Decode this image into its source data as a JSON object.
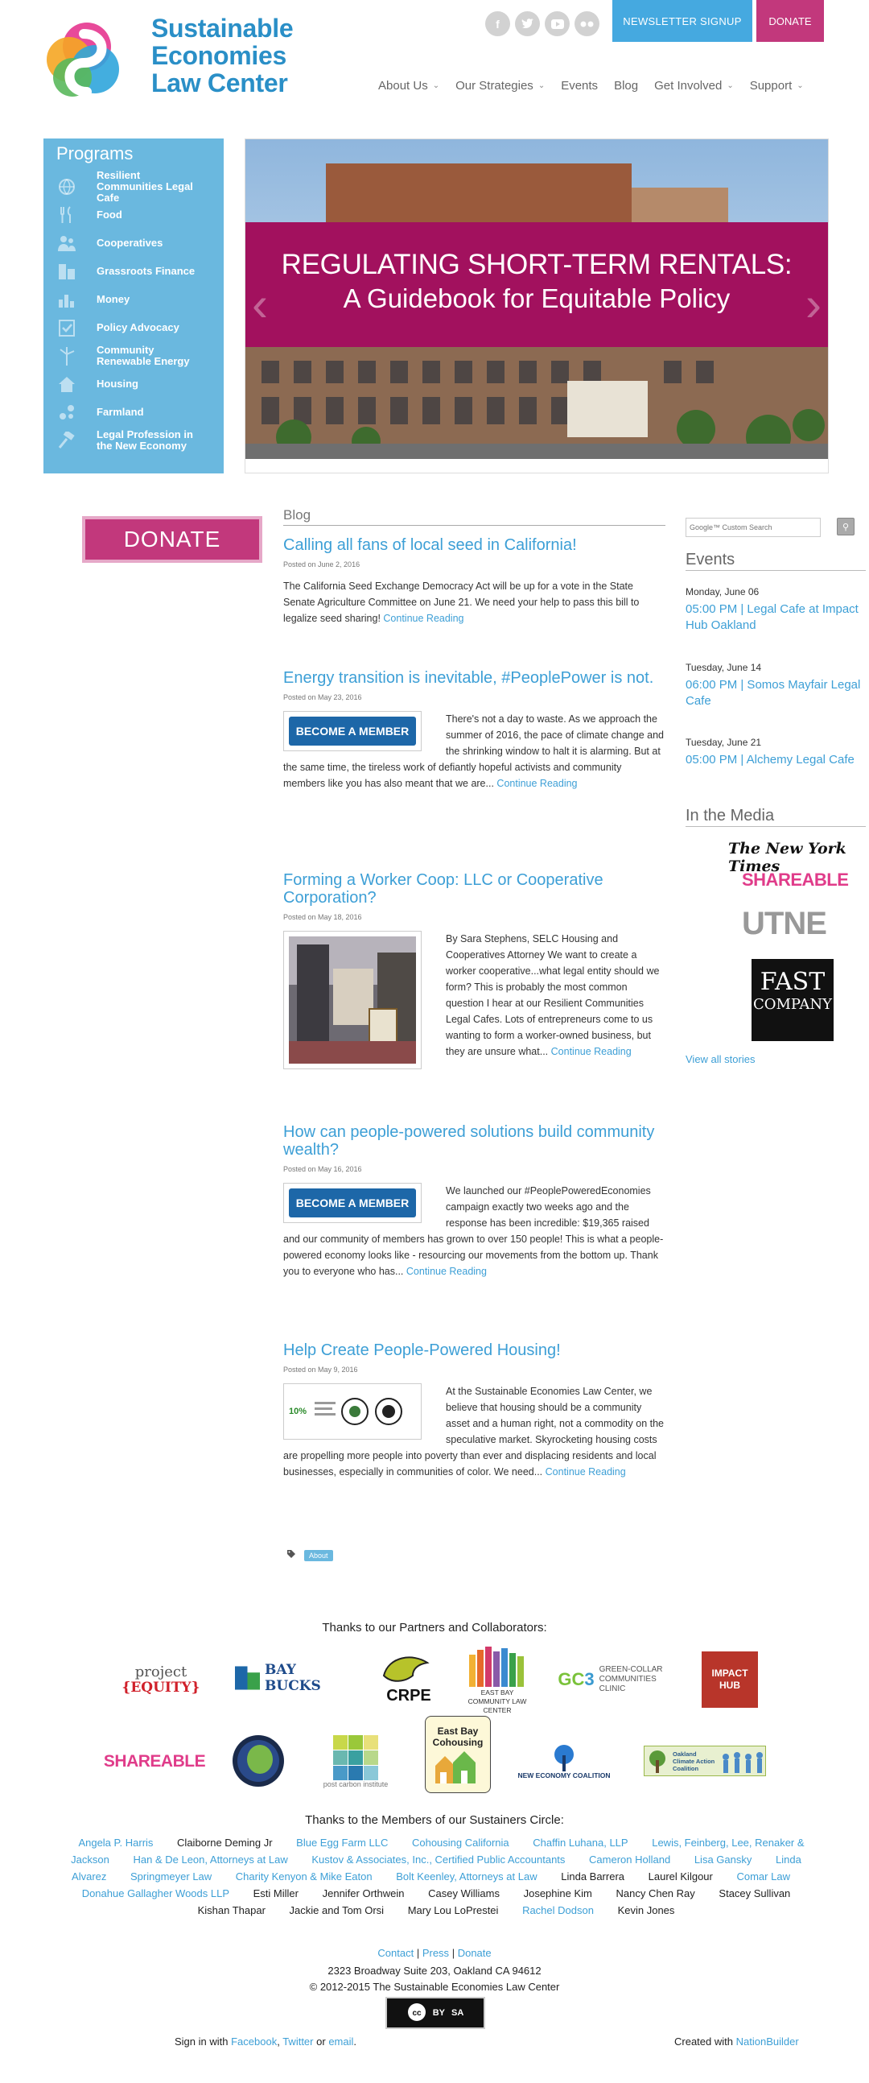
{
  "header": {
    "logo_lines": [
      "Sustainable",
      "Economies",
      "Law Center"
    ],
    "social_icons": [
      "facebook-icon",
      "twitter-icon",
      "youtube-icon",
      "flickr-icon"
    ],
    "newsletter_label": "NEWSLETTER SIGNUP",
    "donate_label": "DONATE",
    "nav": [
      "About Us",
      "Our Strategies",
      "Events",
      "Blog",
      "Get Involved",
      "Support"
    ]
  },
  "programs": {
    "title": "Programs",
    "items": [
      {
        "label": "Resilient Communities Legal Cafe",
        "icon": "globe-icon"
      },
      {
        "label": "Food",
        "icon": "fork-knife-icon"
      },
      {
        "label": "Cooperatives",
        "icon": "people-icon"
      },
      {
        "label": "Grassroots Finance",
        "icon": "buildings-icon"
      },
      {
        "label": "Money",
        "icon": "bar-chart-icon"
      },
      {
        "label": "Policy Advocacy",
        "icon": "checklist-icon"
      },
      {
        "label": "Community Renewable Energy",
        "icon": "wind-turbine-icon"
      },
      {
        "label": "Housing",
        "icon": "house-icon"
      },
      {
        "label": "Farmland",
        "icon": "seed-icon"
      },
      {
        "label": "Legal Profession in the New Economy",
        "icon": "gavel-icon"
      }
    ]
  },
  "hero": {
    "line1": "REGULATING SHORT-TERM RENTALS:",
    "line2": "A Guidebook for Equitable Policy"
  },
  "sidebar_left": {
    "donate_label": "DONATE"
  },
  "blog": {
    "label": "Blog",
    "continue_label": "Continue Reading",
    "posts": [
      {
        "title": "Calling all fans of local seed in California!",
        "date": "Posted on June 2, 2016",
        "excerpt": "The California Seed Exchange Democracy Act will be up for a vote in the State Senate Agriculture Committee on June 21. We need your help to pass this bill to legalize seed sharing!"
      },
      {
        "title": "Energy transition is inevitable, #PeoplePower is not.",
        "date": "Posted on May 23, 2016",
        "thumb_label": "BECOME A MEMBER",
        "excerpt": "There's not a day to waste. As we approach the summer of 2016, the pace of climate change and the shrinking window to halt it is alarming. But at the same time, the tireless work of defiantly hopeful activists and community members like you has also meant that we are..."
      },
      {
        "title": "Forming a Worker Coop: LLC or Cooperative Corporation?",
        "date": "Posted on May 18, 2016",
        "excerpt": "By Sara Stephens, SELC Housing and Cooperatives Attorney We want to create a worker cooperative...what legal entity should we form? This is probably the most common question I hear at our Resilient Communities Legal Cafes. Lots of entrepreneurs come to us wanting to form a worker-owned business, but they are unsure what..."
      },
      {
        "title": "How can people-powered solutions build community wealth?",
        "date": "Posted on May 16, 2016",
        "thumb_label": "BECOME A MEMBER",
        "excerpt": "We launched our #PeoplePoweredEconomies campaign exactly two weeks ago and the response has been incredible: $19,365 raised and our community of members has grown to over 150 people! This is what a people-powered economy looks like - resourcing our movements from the bottom up. Thank you to everyone who has..."
      },
      {
        "title": "Help Create People-Powered Housing!",
        "date": "Posted on May 9, 2016",
        "thumb_label": "10%",
        "excerpt": "At the Sustainable Economies Law Center, we believe that housing should be a community asset and a human right, not a commodity on the speculative market. Skyrocketing housing costs are propelling more people into poverty than ever and displacing residents and local businesses, especially in communities of color. We need..."
      }
    ],
    "tag": "About"
  },
  "search": {
    "placeholder": "Google™ Custom Search"
  },
  "events": {
    "title": "Events",
    "items": [
      {
        "date": "Monday, June 06",
        "text": "05:00 PM | Legal Cafe at Impact Hub Oakland"
      },
      {
        "date": "Tuesday, June 14",
        "text": "06:00 PM | Somos Mayfair Legal Cafe"
      },
      {
        "date": "Tuesday, June 21",
        "text": "05:00 PM | Alchemy Legal Cafe"
      }
    ]
  },
  "media": {
    "title": "In the Media",
    "nyt": "The New York Times",
    "shareable": "SHAREABLE",
    "utne": "UTNE",
    "fast_company_1": "FAST",
    "fast_company_2": "COMPANY",
    "view_all": "View all stories"
  },
  "partners": {
    "title": "Thanks to our Partners and Collaborators:",
    "project_equity_1": "project",
    "project_equity_2": "{EQUITY}",
    "bay_bucks": "BAY BUCKS",
    "crpe": "CRPE",
    "eastbay_clc": "EAST BAY COMMUNITY LAW CENTER",
    "gc3": "GREEN-COLLAR COMMUNITIES CLINIC",
    "impact_hub": "IMPACT HUB",
    "shareable": "SHAREABLE",
    "post_carbon": "post carbon institute",
    "eastbay_cohousing": "East Bay Cohousing",
    "nec": "NEW ECONOMY COALITION",
    "ocaac": "Oakland Climate Action Coalition"
  },
  "sustainers": {
    "title": "Thanks to the Members of our Sustainers Circle:",
    "names": [
      {
        "n": "Angela P. Harris",
        "link": true
      },
      {
        "n": "Claiborne Deming Jr",
        "link": false
      },
      {
        "n": "Blue Egg Farm LLC",
        "link": true
      },
      {
        "n": "Cohousing California",
        "link": true
      },
      {
        "n": "Chaffin Luhana, LLP",
        "link": true
      },
      {
        "n": "Lewis, Feinberg, Lee, Renaker & Jackson",
        "link": true
      },
      {
        "n": "Han & De Leon, Attorneys at Law",
        "link": true
      },
      {
        "n": "Kustov & Associates, Inc., Certified Public Accountants",
        "link": true
      },
      {
        "n": "Cameron Holland",
        "link": true
      },
      {
        "n": "Lisa Gansky",
        "link": true
      },
      {
        "n": "Linda Alvarez",
        "link": true
      },
      {
        "n": "Springmeyer Law",
        "link": true
      },
      {
        "n": "Charity Kenyon & Mike Eaton",
        "link": true
      },
      {
        "n": "Bolt Keenley, Attorneys at Law",
        "link": true
      },
      {
        "n": "Linda Barrera",
        "link": false
      },
      {
        "n": "Laurel Kilgour",
        "link": false
      },
      {
        "n": "Comar Law",
        "link": true
      },
      {
        "n": "Donahue Gallagher Woods LLP",
        "link": true
      },
      {
        "n": "Esti Miller",
        "link": false
      },
      {
        "n": "Jennifer Orthwein",
        "link": false
      },
      {
        "n": "Casey Williams",
        "link": false
      },
      {
        "n": "Josephine Kim",
        "link": false
      },
      {
        "n": "Nancy Chen Ray",
        "link": false
      },
      {
        "n": "Stacey Sullivan",
        "link": false
      },
      {
        "n": "Kishan Thapar",
        "link": false
      },
      {
        "n": "Jackie and Tom Orsi",
        "link": false
      },
      {
        "n": "Mary Lou LoPrestei",
        "link": false
      },
      {
        "n": "Rachel Dodson",
        "link": true
      },
      {
        "n": "Kevin Jones",
        "link": false
      }
    ]
  },
  "footer": {
    "contact": "Contact",
    "press": "Press",
    "donate": "Donate",
    "sep": "|",
    "address": "2323 Broadway Suite 203, Oakland CA 94612",
    "copyright": "© 2012-2015 The Sustainable Economies Law Center",
    "cc_label_1": "BY",
    "cc_label_2": "SA",
    "signin_prefix": "Sign in with",
    "facebook": "Facebook",
    "twitter": "Twitter",
    "or": "or",
    "email": "email",
    "created_with": "Created with",
    "nationbuilder": "NationBuilder"
  },
  "colors": {
    "accent_blue": "#3d9fd6",
    "program_blue": "#6ab8df",
    "magenta": "#c2387c",
    "hero_band": "#a2115e"
  }
}
